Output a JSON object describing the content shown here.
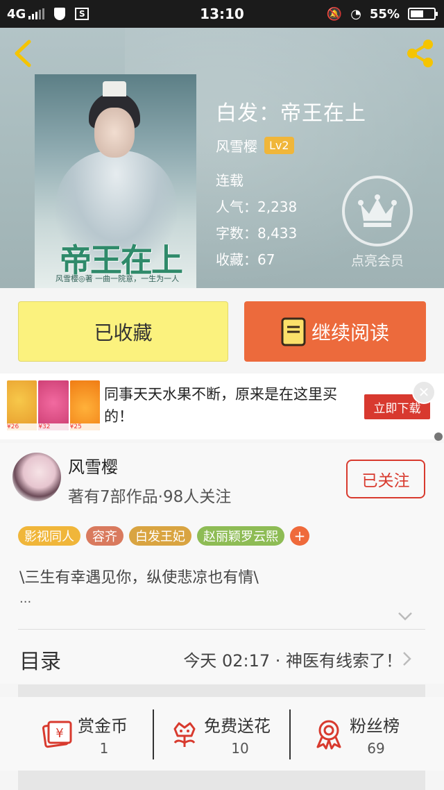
{
  "status_bar": {
    "network": "4G",
    "time": "13:10",
    "battery": "55%",
    "battery_level": 0.55
  },
  "header": {
    "book_title": "白发：帝王在上",
    "author": "风雪樱",
    "level": "Lv2",
    "status": "连载",
    "popularity": "人气：2,238",
    "word_count": "字数：8,433",
    "favorites": "收藏：67",
    "vip_label": "点亮会员",
    "cover_title": "帝王在上",
    "cover_sub": "风雪樱◎著  一曲一院意，一生为一人"
  },
  "actions": {
    "favorited_label": "已收藏",
    "continue_label": "继续阅读"
  },
  "ad": {
    "text": "同事天天水果不断，原来是在这里买的！",
    "button": "立即下载",
    "prices": [
      "¥26",
      "¥32",
      "¥25"
    ]
  },
  "author_section": {
    "name": "风雪樱",
    "stats": "著有7部作品·98人关注",
    "follow_label": "已关注",
    "tags": [
      "影视同人",
      "容齐",
      "白发王妃",
      "赵丽颖罗云熙"
    ],
    "tag_colors": [
      "#f0b63a",
      "#d97a5e",
      "#d9a441",
      "#8ebc55"
    ],
    "plus": "+",
    "intro": "\\三生有幸遇见你，纵使悲凉也有情\\",
    "ellipsis": "..."
  },
  "catalog": {
    "label": "目录",
    "latest": "今天 02:17 · 神医有线索了！"
  },
  "stats": {
    "reward": {
      "label": "赏金币",
      "value": "1"
    },
    "flowers": {
      "label": "免费送花",
      "value": "10"
    },
    "fans": {
      "label": "粉丝榜",
      "value": "69"
    }
  },
  "colors": {
    "accent": "#ec6a3c",
    "favorite": "#fbf27e",
    "follow": "#d83a2e",
    "icon_red": "#d83a2e"
  }
}
